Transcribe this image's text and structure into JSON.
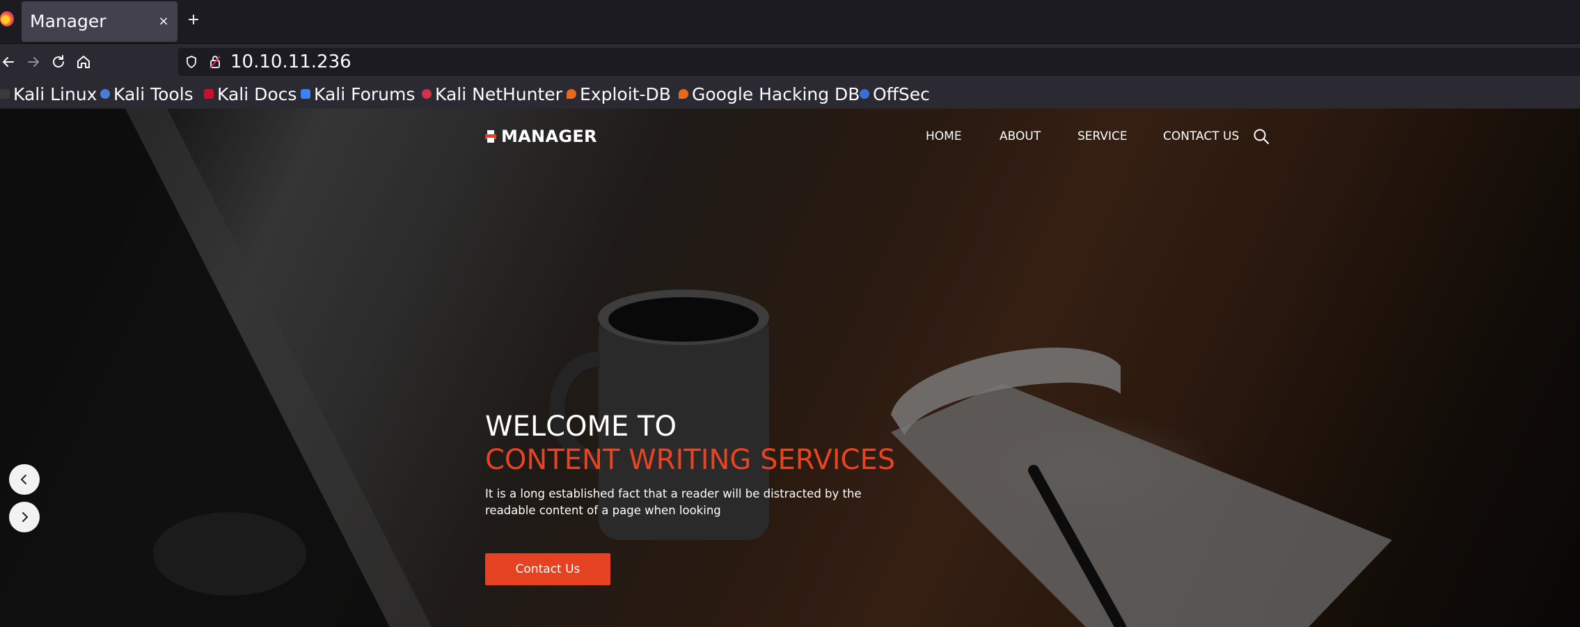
{
  "browser": {
    "tab": {
      "title": "Manager",
      "close_glyph": "×"
    },
    "new_tab_glyph": "+",
    "url": "10.10.11.236",
    "bookmarks": [
      {
        "label": "Kali Linux",
        "icon": "kali-dragon-icon",
        "color": "#3a3a3a"
      },
      {
        "label": "Kali Tools",
        "icon": "kali-tools-icon",
        "color": "#4a7cd6"
      },
      {
        "label": "Kali Docs",
        "icon": "kali-docs-icon",
        "color": "#c8102e"
      },
      {
        "label": "Kali Forums",
        "icon": "kali-forums-icon",
        "color": "#3b82f6"
      },
      {
        "label": "Kali NetHunter",
        "icon": "kali-nethunter-icon",
        "color": "#d0314b"
      },
      {
        "label": "Exploit-DB",
        "icon": "exploit-db-icon",
        "color": "#e8691c"
      },
      {
        "label": "Google Hacking DB",
        "icon": "ghdb-icon",
        "color": "#e8691c"
      },
      {
        "label": "OffSec",
        "icon": "offsec-icon",
        "color": "#3a6fd8"
      }
    ]
  },
  "site": {
    "logo": "MANAGER",
    "menu": [
      "HOME",
      "ABOUT",
      "SERVICE",
      "CONTACT US"
    ],
    "hero": {
      "line1": "WELCOME TO",
      "line2": "CONTENT WRITING SERVICES",
      "description": "It is a long established fact that a reader will be distracted by the readable content of a page when looking",
      "button": "Contact Us"
    },
    "colors": {
      "accent": "#e54222",
      "text": "#ffffff"
    }
  }
}
